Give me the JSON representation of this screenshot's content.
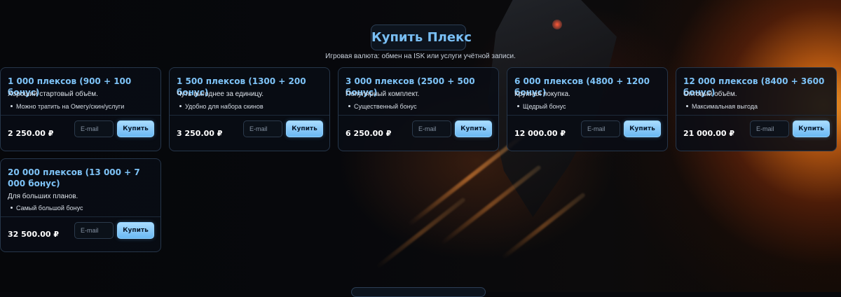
{
  "header": {
    "title": "Купить Плекс",
    "subtitle": "Игровая валюта: обмен на ISK или услуги учётной записи."
  },
  "products": [
    {
      "title": "1 000 плексов (900 + 100 бонус)",
      "description": "Хороший стартовый объём.",
      "features": [
        "Можно тратить на Омегу/скин/услуги"
      ],
      "price": "2 250.00 ₽",
      "email_placeholder": "E-mail",
      "buy_label": "Купить"
    },
    {
      "title": "1 500 плексов (1300 + 200 бонус)",
      "description": "Чуть выгоднее за единицу.",
      "features": [
        "Удобно для набора скинов"
      ],
      "price": "3 250.00 ₽",
      "email_placeholder": "E-mail",
      "buy_label": "Купить"
    },
    {
      "title": "3 000 плексов (2500 + 500 бонус)",
      "description": "Популярный комплект.",
      "features": [
        "Существенный бонус"
      ],
      "price": "6 250.00 ₽",
      "email_placeholder": "E-mail",
      "buy_label": "Купить"
    },
    {
      "title": "6 000 плексов (4800 + 1200 бонус)",
      "description": "Крупная покупка.",
      "features": [
        "Щедрый бонус"
      ],
      "price": "12 000.00 ₽",
      "email_placeholder": "E-mail",
      "buy_label": "Купить"
    },
    {
      "title": "12 000 плексов (8400 + 3600 бонус)",
      "description": "Оптовый объём.",
      "features": [
        "Максимальная выгода"
      ],
      "price": "21 000.00 ₽",
      "email_placeholder": "E-mail",
      "buy_label": "Купить"
    },
    {
      "title": "20 000 плексов (13 000 + 7 000 бонус)",
      "description": "Для больших планов.",
      "features": [
        "Самый большой бонус"
      ],
      "price": "32 500.00 ₽",
      "email_placeholder": "E-mail",
      "buy_label": "Купить"
    }
  ],
  "colors": {
    "accent": "#79bff5",
    "button": "#8fd0ff",
    "card_border": "#26364a"
  }
}
